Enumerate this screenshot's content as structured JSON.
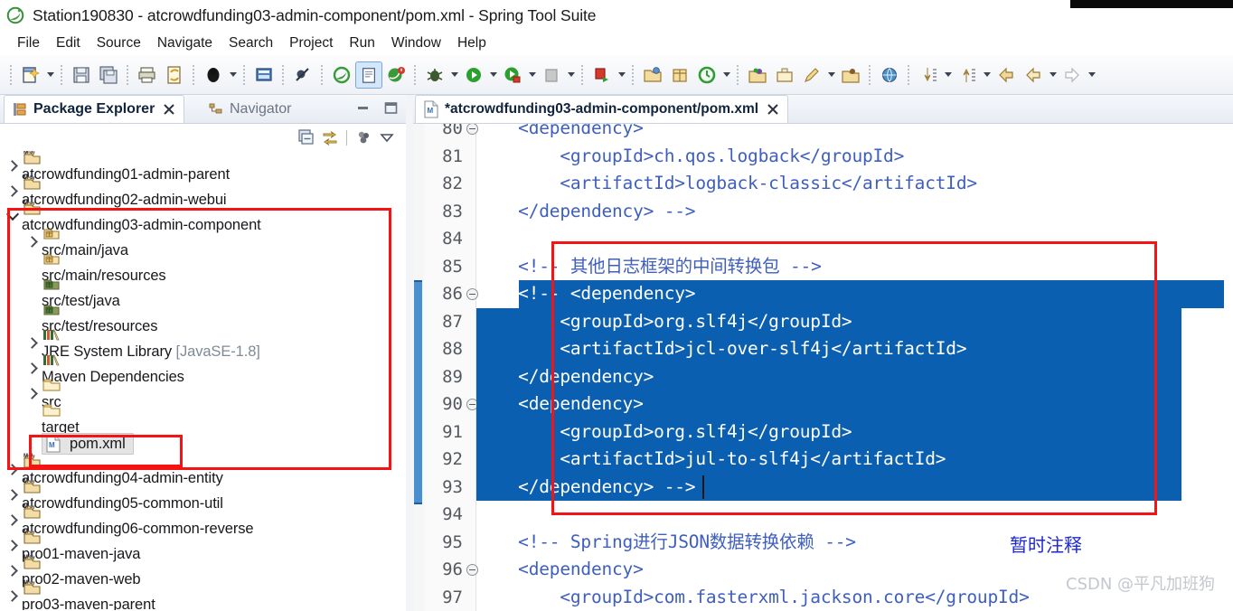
{
  "window": {
    "title": "Station190830 - atcrowdfunding03-admin-component/pom.xml - Spring Tool Suite",
    "logo_icon": "spring-tool-suite-logo-icon"
  },
  "menubar": {
    "items": [
      {
        "label": "File"
      },
      {
        "label": "Edit"
      },
      {
        "label": "Source"
      },
      {
        "label": "Navigate"
      },
      {
        "label": "Search"
      },
      {
        "label": "Project"
      },
      {
        "label": "Run"
      },
      {
        "label": "Window"
      },
      {
        "label": "Help"
      }
    ]
  },
  "toolbar": {
    "buttons": [
      {
        "name": "new-wizard-icon",
        "dropdown": true
      },
      {
        "sep": true
      },
      {
        "name": "save-icon",
        "dropdown": false
      },
      {
        "name": "save-all-icon",
        "dropdown": false
      },
      {
        "sep": true
      },
      {
        "name": "print-icon",
        "dropdown": false
      },
      {
        "name": "refresh-file-icon",
        "dropdown": false
      },
      {
        "sep": true
      },
      {
        "name": "boot-dashboard-icon",
        "dropdown": true
      },
      {
        "sep": true
      },
      {
        "name": "open-console-icon",
        "dropdown": false
      },
      {
        "sep": true
      },
      {
        "name": "skip-breakpoints-icon",
        "dropdown": false
      },
      {
        "sep": true
      },
      {
        "name": "spring-icon",
        "dropdown": false
      },
      {
        "name": "new-java-class-icon",
        "dropdown": false,
        "selected": true
      },
      {
        "name": "spring-boot-icon",
        "dropdown": false
      },
      {
        "sep": true
      },
      {
        "name": "debug-icon",
        "dropdown": true
      },
      {
        "name": "run-icon",
        "dropdown": true
      },
      {
        "name": "run-secure-icon",
        "dropdown": true
      },
      {
        "name": "terminate-icon",
        "dropdown": true
      },
      {
        "sep": true
      },
      {
        "name": "external-tools-icon",
        "dropdown": true
      },
      {
        "sep": true
      },
      {
        "name": "new-java-project-icon",
        "dropdown": false
      },
      {
        "name": "new-package-icon",
        "dropdown": false
      },
      {
        "name": "new-annotation-icon",
        "dropdown": true
      },
      {
        "sep": true
      },
      {
        "name": "open-type-icon",
        "dropdown": false
      },
      {
        "name": "open-task-icon",
        "dropdown": false
      },
      {
        "name": "search-marker-icon",
        "dropdown": true
      },
      {
        "name": "open-resource-icon",
        "dropdown": false
      },
      {
        "sep": true
      },
      {
        "name": "open-web-browser-icon",
        "dropdown": false
      },
      {
        "sep": true
      },
      {
        "name": "next-annotation-icon",
        "dropdown": true
      },
      {
        "name": "previous-annotation-icon",
        "dropdown": true
      },
      {
        "name": "back-history-icon",
        "dropdown": false
      },
      {
        "name": "previous-edit-icon",
        "dropdown": true
      },
      {
        "name": "forward-history-icon",
        "dropdown": true
      }
    ]
  },
  "package_explorer": {
    "tab_label": "Package Explorer",
    "tab_icon": "package-explorer-icon",
    "close_icon": "close-icon",
    "inactive_tab_label": "Navigator",
    "inactive_tab_icon": "navigator-icon",
    "minimize_icon": "minimize-icon",
    "maximize_icon": "maximize-icon",
    "view_tools": [
      {
        "name": "collapse-all-icon"
      },
      {
        "name": "link-with-editor-icon"
      },
      {
        "name": "filter-icon"
      },
      {
        "name": "view-menu-icon"
      }
    ],
    "tree": [
      {
        "label": "atcrowdfunding01-admin-parent",
        "icon": "maven-java-project-icon",
        "twisty": "closed",
        "indent": 0
      },
      {
        "label": "atcrowdfunding02-admin-webui",
        "icon": "maven-web-project-icon",
        "twisty": "closed",
        "indent": 0
      },
      {
        "label": "atcrowdfunding03-admin-component",
        "icon": "maven-java-project-icon",
        "twisty": "open",
        "indent": 0
      },
      {
        "label": "src/main/java",
        "icon": "source-folder-icon",
        "twisty": "closed",
        "indent": 1
      },
      {
        "label": "src/main/resources",
        "icon": "source-folder-icon",
        "twisty": "none",
        "indent": 1
      },
      {
        "label": "src/test/java",
        "icon": "test-source-folder-icon",
        "twisty": "none",
        "indent": 1
      },
      {
        "label": "src/test/resources",
        "icon": "test-source-folder-icon",
        "twisty": "none",
        "indent": 1
      },
      {
        "label": "JRE System Library",
        "suffix": " [JavaSE-1.8]",
        "icon": "library-icon",
        "twisty": "closed",
        "indent": 1
      },
      {
        "label": "Maven Dependencies",
        "icon": "library-icon",
        "twisty": "closed",
        "indent": 1
      },
      {
        "label": "src",
        "icon": "folder-icon",
        "twisty": "closed",
        "indent": 1
      },
      {
        "label": "target",
        "icon": "folder-icon",
        "twisty": "none",
        "indent": 1
      },
      {
        "label": "pom.xml",
        "icon": "maven-pom-file-icon",
        "twisty": "none",
        "indent": 1,
        "selected": true
      },
      {
        "label": "atcrowdfunding04-admin-entity",
        "icon": "maven-java-project-icon",
        "twisty": "closed",
        "indent": 0
      },
      {
        "label": "atcrowdfunding05-common-util",
        "icon": "maven-java-project-icon",
        "twisty": "closed",
        "indent": 0
      },
      {
        "label": "atcrowdfunding06-common-reverse",
        "icon": "maven-java-project-icon",
        "twisty": "closed",
        "indent": 0
      },
      {
        "label": "pro01-maven-java",
        "icon": "maven-java-project-icon",
        "twisty": "closed",
        "indent": 0
      },
      {
        "label": "pro02-maven-web",
        "icon": "maven-web-project-icon",
        "twisty": "closed",
        "indent": 0
      },
      {
        "label": "pro03-maven-parent",
        "icon": "maven-java-project-icon",
        "twisty": "closed",
        "indent": 0
      }
    ]
  },
  "editor": {
    "tab_label": "*atcrowdfunding03-admin-component/pom.xml",
    "tab_icon": "maven-pom-file-icon",
    "close_icon": "close-icon",
    "lines": [
      {
        "num": "80",
        "fold": true,
        "text": "    <dependency>",
        "partial_top": true
      },
      {
        "num": "81",
        "fold": false,
        "text": "        <groupId>ch.qos.logback</groupId>"
      },
      {
        "num": "82",
        "fold": false,
        "text": "        <artifactId>logback-classic</artifactId>"
      },
      {
        "num": "83",
        "fold": false,
        "text": "    </dependency> -->"
      },
      {
        "num": "84",
        "fold": false,
        "text": ""
      },
      {
        "num": "85",
        "fold": false,
        "text": "    <!-- 其他日志框架的中间转换包 -->"
      },
      {
        "num": "86",
        "fold": true,
        "text": "    <!-- <dependency>",
        "selected": true
      },
      {
        "num": "87",
        "fold": false,
        "text": "        <groupId>org.slf4j</groupId>",
        "selected": true
      },
      {
        "num": "88",
        "fold": false,
        "text": "        <artifactId>jcl-over-slf4j</artifactId>",
        "selected": true
      },
      {
        "num": "89",
        "fold": false,
        "text": "    </dependency>",
        "selected": true
      },
      {
        "num": "90",
        "fold": true,
        "text": "    <dependency>",
        "selected": true
      },
      {
        "num": "91",
        "fold": false,
        "text": "        <groupId>org.slf4j</groupId>",
        "selected": true
      },
      {
        "num": "92",
        "fold": false,
        "text": "        <artifactId>jul-to-slf4j</artifactId>",
        "selected": true
      },
      {
        "num": "93",
        "fold": false,
        "text": "    </dependency> -->",
        "selected": true
      },
      {
        "num": "94",
        "fold": false,
        "text": ""
      },
      {
        "num": "95",
        "fold": false,
        "text": "    <!-- Spring进行JSON数据转换依赖 -->"
      },
      {
        "num": "96",
        "fold": true,
        "text": "    <dependency>"
      },
      {
        "num": "97",
        "fold": false,
        "text": "        <groupId>com.fasterxml.jackson.core</groupId>",
        "partial_bottom": true
      }
    ],
    "annotation_note": "暂时注释",
    "watermark": "CSDN @平凡加班狗"
  },
  "colors": {
    "selection_blue": "#0b5fb0",
    "annotation_red": "#f51414",
    "annotation_note_blue": "#1e28d6",
    "code_blue": "#3f5fbf",
    "change_bar_blue": "#4a8fd0"
  }
}
